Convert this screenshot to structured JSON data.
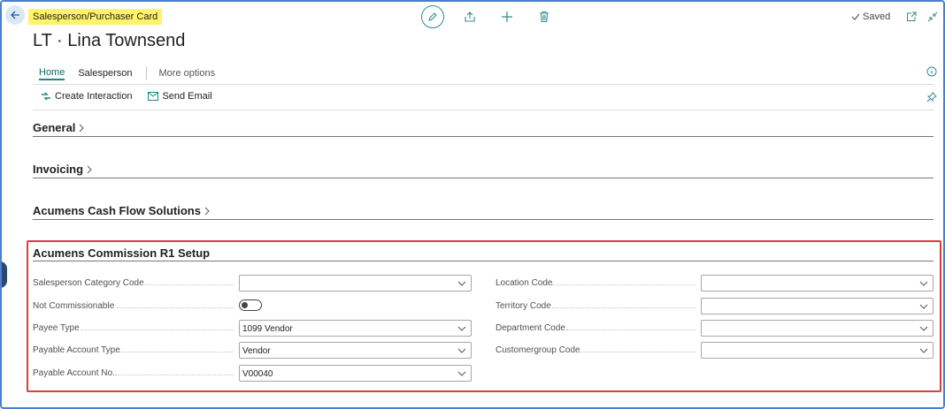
{
  "breadcrumb": "Salesperson/Purchaser Card",
  "title": "LT · Lina Townsend",
  "status": {
    "saved_label": "Saved"
  },
  "tabs": [
    {
      "label": "Home",
      "active": true
    },
    {
      "label": "Salesperson",
      "active": false
    },
    {
      "label": "More options",
      "active": false
    }
  ],
  "actions": [
    {
      "label": "Create Interaction",
      "icon": "interaction-icon"
    },
    {
      "label": "Send Email",
      "icon": "email-icon"
    }
  ],
  "sections": [
    {
      "label": "General",
      "collapsed": true
    },
    {
      "label": "Invoicing",
      "collapsed": true
    },
    {
      "label": "Acumens Cash Flow Solutions",
      "collapsed": true
    }
  ],
  "setup": {
    "title": "Acumens Commission R1 Setup",
    "left_fields": [
      {
        "label": "Salesperson Category Code",
        "value": "",
        "kind": "select"
      },
      {
        "label": "Not Commissionable",
        "value": "off",
        "kind": "toggle"
      },
      {
        "label": "Payee Type",
        "value": "1099 Vendor",
        "kind": "select"
      },
      {
        "label": "Payable Account Type",
        "value": "Vendor",
        "kind": "select"
      },
      {
        "label": "Payable Account No.",
        "value": "V00040",
        "kind": "select"
      }
    ],
    "right_fields": [
      {
        "label": "Location Code",
        "value": "",
        "kind": "select"
      },
      {
        "label": "Territory Code",
        "value": "",
        "kind": "select"
      },
      {
        "label": "Department Code",
        "value": "",
        "kind": "select"
      },
      {
        "label": "Customergroup Code",
        "value": "",
        "kind": "select"
      }
    ]
  },
  "colors": {
    "accent": "#1e8787",
    "highlight_box": "#e03c3c",
    "breadcrumb_bg": "#fff36b",
    "frame": "#4a7fd0"
  }
}
